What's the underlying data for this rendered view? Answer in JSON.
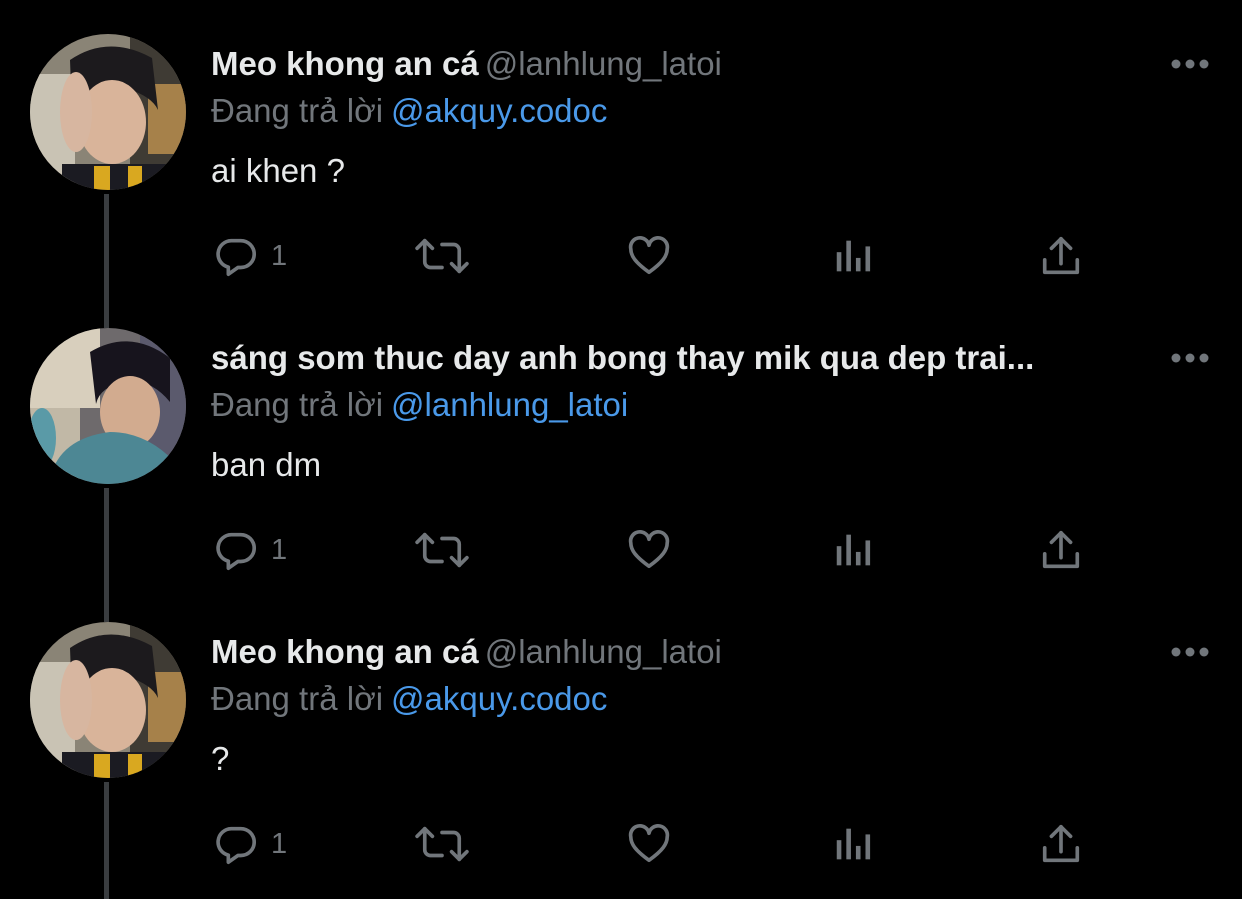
{
  "colors": {
    "background": "#000000",
    "primary_text": "#e7e9ea",
    "secondary_text": "#71767b",
    "link": "#4a99e9",
    "thread_line": "#3a3d40"
  },
  "icons": {
    "reply": "speech-bubble-icon",
    "retweet": "retweet-icon",
    "like": "heart-icon",
    "views": "bar-chart-icon",
    "share": "share-upload-icon",
    "more": "more-horizontal-icon"
  },
  "tweets": [
    {
      "display_name": "Meo khong an cá",
      "handle": "@lanhlung_latoi",
      "replying_label": "Đang trả lời",
      "replying_to": "@akquy.codoc",
      "text": "ai khen ?",
      "reply_count": "1"
    },
    {
      "display_name": "sáng som thuc day anh bong thay mik qua dep trai...",
      "handle": "",
      "replying_label": "Đang trả lời",
      "replying_to": "@lanhlung_latoi",
      "text": "ban dm",
      "reply_count": "1"
    },
    {
      "display_name": "Meo khong an cá",
      "handle": "@lanhlung_latoi",
      "replying_label": "Đang trả lời",
      "replying_to": "@akquy.codoc",
      "text": "?",
      "reply_count": "1"
    }
  ]
}
